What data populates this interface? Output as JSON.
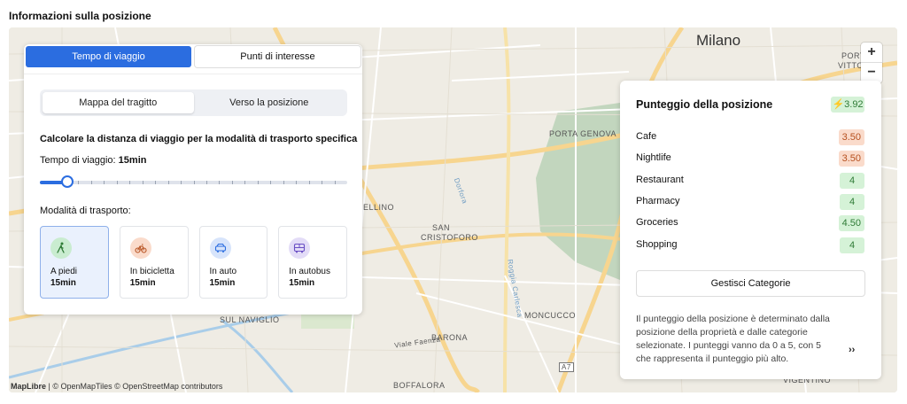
{
  "page_title": "Informazioni sulla posizione",
  "map": {
    "city_label": "Milano",
    "labels": [
      "PORTA GENOVA",
      "SAN",
      "CRISTOFORO",
      "ELLINO",
      "SUL NAVIGLIO",
      "MONCUCCO",
      "BARONA",
      "BOFFALORA",
      "VIGENTINO",
      "PORT",
      "VITTO",
      "A7",
      "Viale Faenza",
      "Roggia Carlesca",
      "Dorfora"
    ],
    "zoom_in": "+",
    "zoom_out": "−",
    "attribution_brand": "MapLibre",
    "attribution_rest": " | © OpenMapTiles © OpenStreetMap contributors"
  },
  "left_panel": {
    "tabs": [
      {
        "label": "Tempo di viaggio",
        "active": true
      },
      {
        "label": "Punti di interesse",
        "active": false
      }
    ],
    "segment": [
      {
        "label": "Mappa del tragitto",
        "active": true
      },
      {
        "label": "Verso la posizione",
        "active": false
      }
    ],
    "calc_title": "Calcolare la distanza di viaggio per la modalità di trasporto specifica",
    "time_prefix": "Tempo di viaggio: ",
    "time_value": "15min",
    "slider_fraction": 0.09,
    "modes_label": "Modalità di trasporto:",
    "modes": [
      {
        "name": "A piedi",
        "time": "15min",
        "icon": "walk-icon",
        "color": "#c9ecd0",
        "icon_color": "#2f7b36",
        "active": true
      },
      {
        "name": "In bicicletta",
        "time": "15min",
        "icon": "bicycle-icon",
        "color": "#fadbcb",
        "icon_color": "#b6501f",
        "active": false
      },
      {
        "name": "In auto",
        "time": "15min",
        "icon": "car-icon",
        "color": "#d7e4fb",
        "icon_color": "#2b6de0",
        "active": false
      },
      {
        "name": "In autobus",
        "time": "15min",
        "icon": "bus-icon",
        "color": "#e3dcf7",
        "icon_color": "#6a4fc4",
        "active": false
      }
    ]
  },
  "right_panel": {
    "title": "Punteggio della posizione",
    "overall_icon": "bolt-icon",
    "overall_score": "3.92",
    "categories": [
      {
        "name": "Cafe",
        "score": "3.50",
        "tone": "orange"
      },
      {
        "name": "Nightlife",
        "score": "3.50",
        "tone": "orange"
      },
      {
        "name": "Restaurant",
        "score": "4",
        "tone": "green"
      },
      {
        "name": "Pharmacy",
        "score": "4",
        "tone": "green"
      },
      {
        "name": "Groceries",
        "score": "4.50",
        "tone": "green"
      },
      {
        "name": "Shopping",
        "score": "4",
        "tone": "green"
      }
    ],
    "manage_label": "Gestisci Categorie",
    "description": "Il punteggio della posizione è determinato dalla posizione della proprietà e dalle categorie selezionate. I punteggi vanno da 0 a 5, con 5 che rappresenta il punteggio più alto.",
    "more_label": "››"
  }
}
